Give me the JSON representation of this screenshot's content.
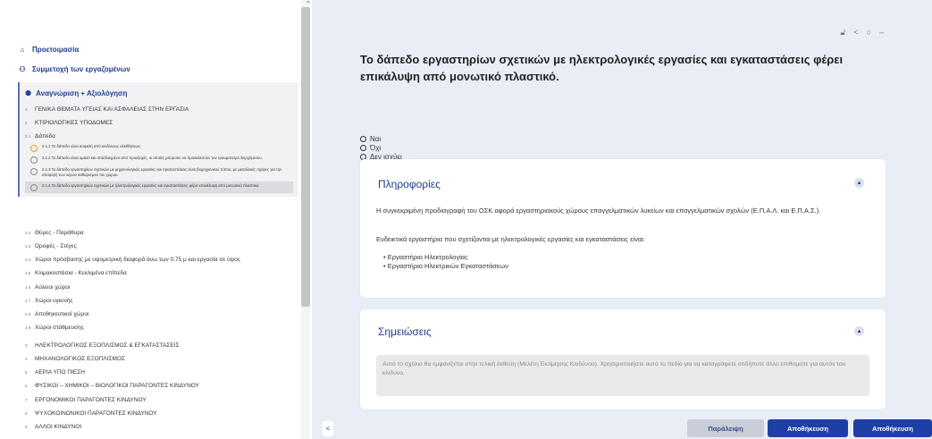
{
  "sidebar": {
    "nav": [
      {
        "label": "Προετοιμασία"
      },
      {
        "label": "Συμμετοχή των εργαζομένων"
      }
    ],
    "section_title": "Αναγνώριση + Αξιολόγηση",
    "section_items": [
      {
        "num": "1",
        "label": "ΓΕΝΙΚΑ ΘΕΜΑΤΑ ΥΓΕΙΑΣ ΚΑΙ ΑΣΦΑΛΕΙΑΣ ΣΤΗΝ ΕΡΓΑΣΙΑ"
      },
      {
        "num": "2",
        "label": "ΚΤΙΡΙΟΛΟΓΙΚΕΣ ΥΠΟΔΟΜΕΣ"
      },
      {
        "num": "2.1",
        "label": "Δάπεδα"
      }
    ],
    "subitems": [
      {
        "text": "2.1.1 Το δάπεδο είναι ασφαλή από κινδύνους ολισθήσεως."
      },
      {
        "text": "2.1.2 Το δάπεδο είναι ομαλό και απαλλαγμένο από προεξοχές, οι οποίες μπορούν να προκαλέσουν τον τραυματισμό διερχόμενου."
      },
      {
        "text": "2.1.3 Το δάπεδο εργαστηρίων σχετικών με μηχανολογικές εργασίες και εγκαταστάσεις είναι βιομηχανικού τύπου, με μεταλλικές σχάρες για την αποφυγή των νερών καθαρισμού του χώρου."
      },
      {
        "text": "2.1.4 Το δάπεδο εργαστηρίων σχετικών με ηλεκτρολογικές εργασίες και εγκαταστάσεις φέρει επικάλυψη από μονωτικό πλαστικό."
      }
    ],
    "items": [
      {
        "num": "2.2",
        "label": "Θύρες - Παράθυρα"
      },
      {
        "num": "2.3",
        "label": "Οροφές - Στέγες"
      },
      {
        "num": "2.4",
        "label": "Χώροι πρόσβασης με υψομετρική διαφορά άνω των 0,75 μ και εργασία σε ύψος"
      },
      {
        "num": "2.5",
        "label": "Κλιμακοστάσια - Κεκλιμένα επίπεδα"
      },
      {
        "num": "2.6",
        "label": "Αύλειοι χώροι"
      },
      {
        "num": "2.7",
        "label": "Χώροι υγιεινής"
      },
      {
        "num": "2.8",
        "label": "Αποθηκευτικοί χώροι"
      },
      {
        "num": "2.9",
        "label": "Χώροι στάθμευσης"
      },
      {
        "num": "3",
        "label": "ΗΛΕΚΤΡΟΛΟΓΙΚΟΣ ΕΞΟΠΛΙΣΜΟΣ & ΕΓΚΑΤΑΣΤΑΣΕΙΣ"
      },
      {
        "num": "4",
        "label": "ΜΗΧΑΝΟΛΟΓΙΚΟΣ ΕΞΟΠΛΙΣΜΟΣ"
      },
      {
        "num": "5",
        "label": "ΑΕΡΙΑ ΥΠΟ ΠΙΕΣΗ"
      },
      {
        "num": "6",
        "label": "ΦΥΣΙΚΟΙ – ΧΗΜΙΚΟΙ – ΒΙΟΛΟΓΙΚΟΙ ΠΑΡΑΓΟΝΤΕΣ ΚΙΝΔΥΝΟΥ"
      },
      {
        "num": "7",
        "label": "ΕΡΓΟΝΟΜΙΚΟΙ ΠΑΡΑΓΟΝΤΕΣ ΚΙΝΔΥΝΟΥ"
      },
      {
        "num": "8",
        "label": "ΨΥΧΟΚΟΙΝΩΝΙΚΟΙ ΠΑΡΑΓΟΝΤΕΣ ΚΙΝΔΥΝΟΥ"
      },
      {
        "num": "9",
        "label": "ΑΛΛΟΙ ΚΙΝΔΥΝΟΙ"
      }
    ]
  },
  "main": {
    "question": "Το δάπεδο εργαστηρίων σχετικών με ηλεκτρολογικές εργασίες και εγκαταστάσεις φέρει επικάλυψη από μονωτικό πλαστικό.",
    "options": [
      "Ναι",
      "Όχι",
      "Δεν ισχύει"
    ],
    "info": {
      "title": "Πληροφορίες",
      "para1": "Η συγκεκριμένη προδιαγραφή του ΟΣΚ αφορά εργαστηριακούς χώρους επαγγελματικών λυκείων και επαγγελματικών σχολών (Ε.Π.Α.Λ. και Ε.Π.Α.Σ.).",
      "para2": "Ενδεικτικά εργαστήρια που σχετίζονται με ηλεκτρολογικές εργασίες και εγκαταστάσεις είναι:",
      "bullets": [
        "Εργαστήριο Ηλεκτρολογίας",
        "Εργαστήριο Ηλεκτρικών Εγκαταστάσεων"
      ]
    },
    "notes": {
      "title": "Σημειώσεις",
      "placeholder": "Αυτό το σχόλιο θα εμφανίζεται στην τελική έκθεση (Μελέτη Εκτίμησης Κινδύνου). Χρησιμοποιήστε αυτό το πεδίο για να καταγράψετε οτιδήποτε άλλο επιθυμείτε για αυτόν τον κίνδυνο."
    },
    "buttons": {
      "skip": "Παράλειψη",
      "save": "Αποθήκευση",
      "save2": "Αποθήκευση"
    }
  },
  "colors": {
    "accent": "#1f3d8c",
    "primary_button": "#1f3fa6",
    "main_bg": "#e9eef6"
  }
}
